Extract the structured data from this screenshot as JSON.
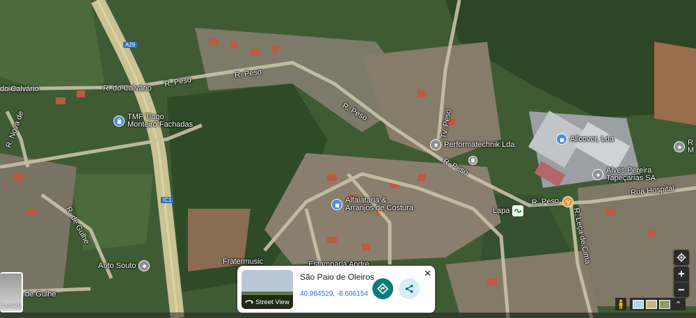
{
  "streets": {
    "r_do_calvario_1": "do Calvário",
    "r_do_calvario_2": "R. do Calvário",
    "r_peso_1": "R. Peso",
    "r_peso_2": "R. Peso",
    "r_peso_3": "R. Peso",
    "r_peso_4": "R. Peso",
    "tv_peso": "Tv. Peso",
    "r_nova": "R. Nova de",
    "r_de_gulhe": "R. de Gulhe",
    "de_gulhe": "de Gulhe",
    "rua_hospital": "Rua Hospital",
    "r_leca": "R. Leça de Cima",
    "a29": "A29",
    "ic1": "IC1"
  },
  "pois": {
    "tmf": [
      "TMF Tiago",
      "Monteiro Fachadas"
    ],
    "performatechnik": "Performatechnik Lda",
    "allcover": "Allcover, Lda",
    "alves": [
      "Alves Pereira",
      "Tapeçarias SA"
    ],
    "alfaiataria": [
      "Alfaiataria &",
      "Arranjos de Costura"
    ],
    "lapa": "Lapa",
    "auto_souto": "Auto Souto",
    "fratermusic": "Fratermusic",
    "estamparia": "Estamparia André",
    "right_edge": [
      "R",
      "M"
    ]
  },
  "info_card": {
    "place_name": "São Paio de Oleiros",
    "coordinates": "40.984529, -8.606154",
    "street_view_label": "Street View"
  },
  "controls": {
    "layers_label": "Camadas",
    "zoom_in": "+",
    "zoom_out": "−"
  },
  "colors": {
    "pin_blue": "#4a8ee0",
    "pin_orange": "#f29a2e",
    "directions_teal": "#0a7d7b"
  }
}
